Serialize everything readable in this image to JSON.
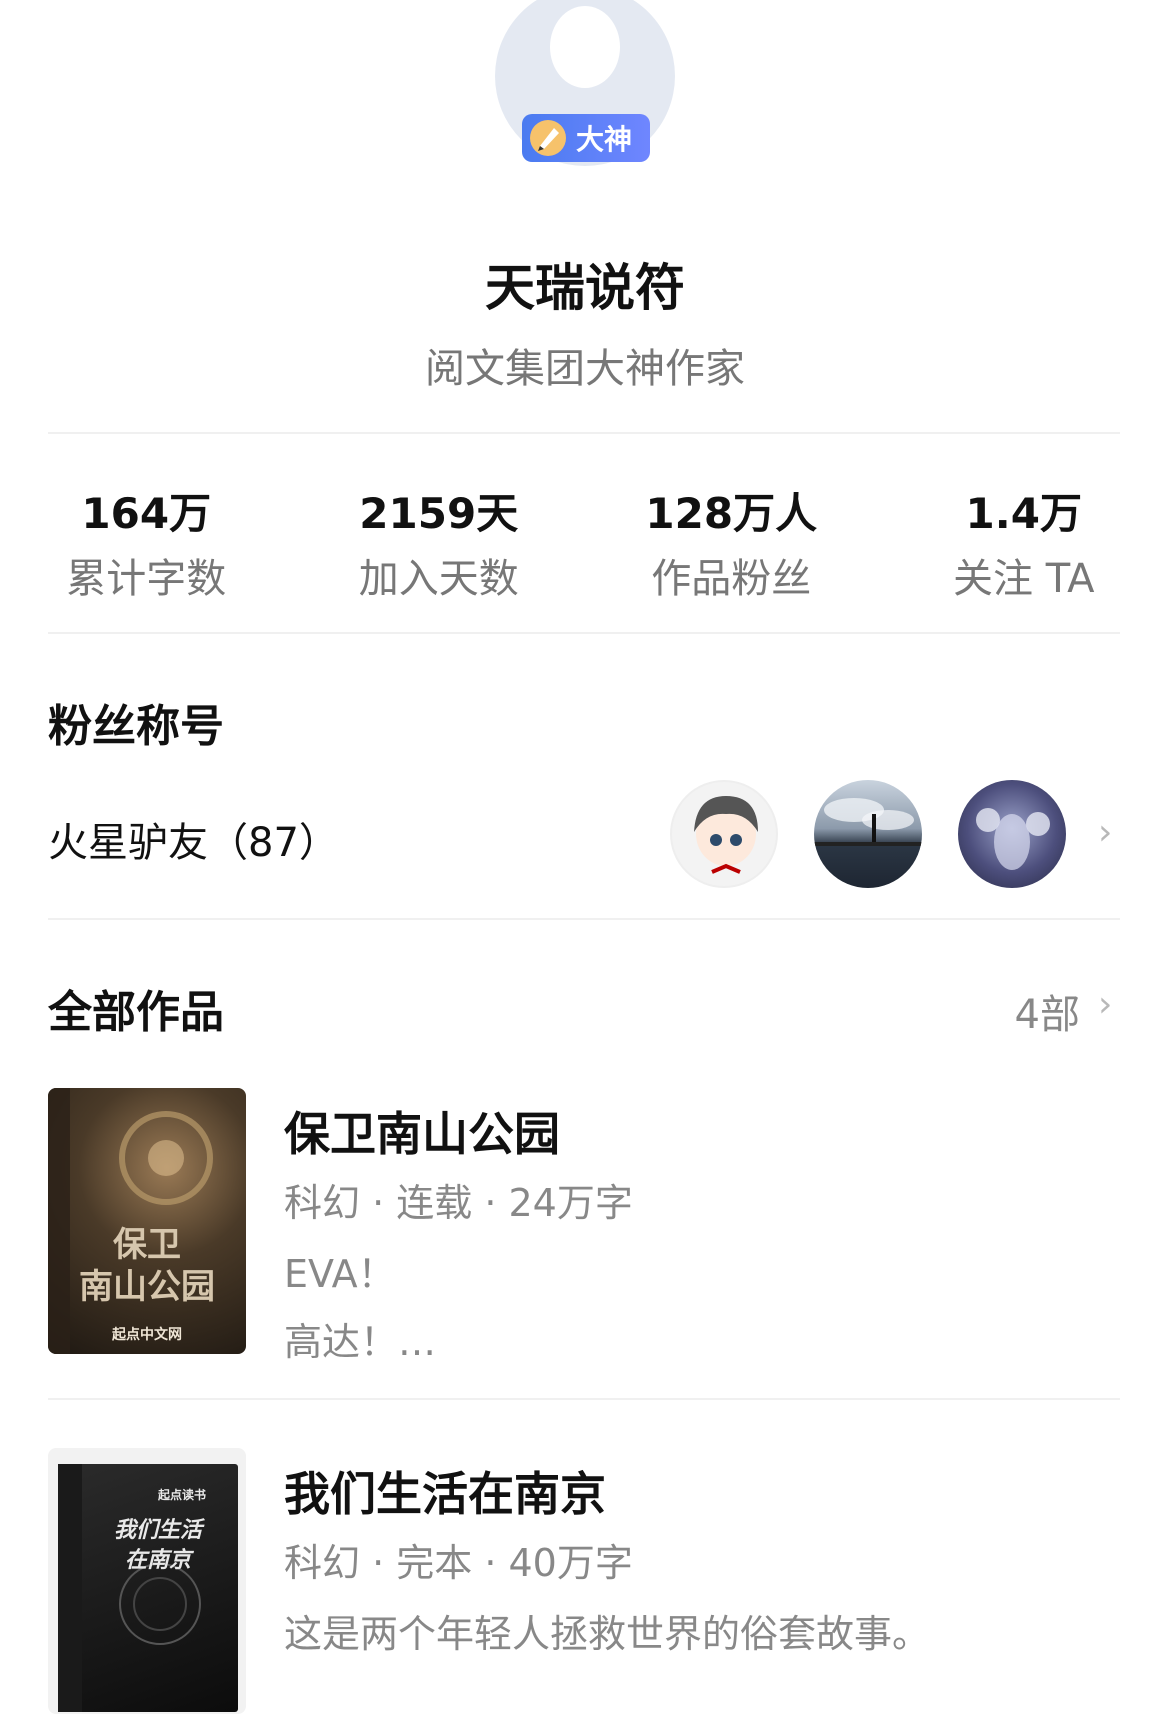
{
  "profile": {
    "badge_label": "大神",
    "name": "天瑞说符",
    "subtitle": "阅文集团大神作家"
  },
  "stats": [
    {
      "value": "164万",
      "label": "累计字数"
    },
    {
      "value": "2159天",
      "label": "加入天数"
    },
    {
      "value": "128万人",
      "label": "作品粉丝"
    },
    {
      "value": "1.4万",
      "label": "关注 TA"
    }
  ],
  "fan_section": {
    "title": "粉丝称号",
    "fan_title": "火星驴友（87）"
  },
  "works_section": {
    "title": "全部作品",
    "count": "4部"
  },
  "books": [
    {
      "title": "保卫南山公园",
      "meta": "科幻 · 连载 · 24万字",
      "desc": "EVA！\n高达！…",
      "cover_text": "保卫\n南山公园",
      "cover_footer": "起点中文网"
    },
    {
      "title": "我们生活在南京",
      "meta": "科幻 · 完本 · 40万字",
      "desc": "这是两个年轻人拯救世界的俗套故事。",
      "cover_text": "我们生活\n在南京",
      "cover_footer": "起点读书"
    }
  ],
  "icons": {
    "chevron": "chevron-right-icon",
    "pen": "pen-icon"
  },
  "colors": {
    "badge": "#4a7bf0",
    "text_primary": "#111111",
    "text_secondary": "#777777"
  }
}
